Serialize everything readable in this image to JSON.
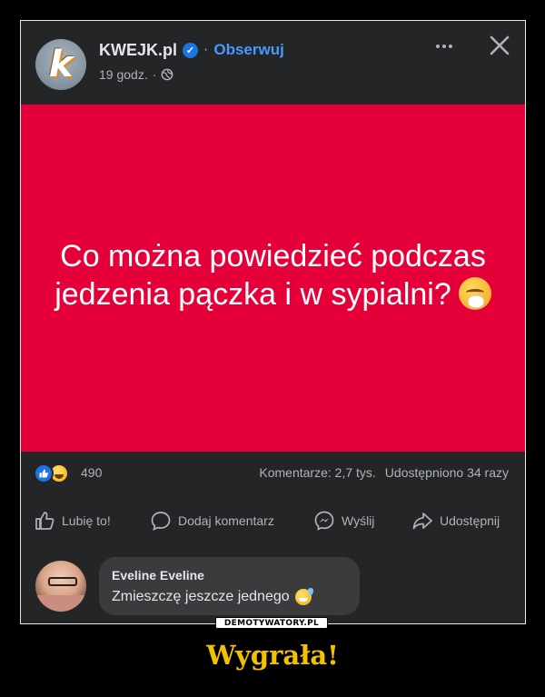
{
  "post": {
    "page_name": "KWEJK.pl",
    "separator": "·",
    "follow_label": "Obserwuj",
    "time": "19 godz.",
    "time_separator": "·",
    "avatar_letter": "k",
    "image_text": "Co można powiedzieć podczas jedzenia pączka i w sypialni?",
    "image_bg_color": "#e5003a"
  },
  "stats": {
    "reactions_count": "490",
    "comments": "Komentarze: 2,7 tys.",
    "shares": "Udostępniono 34 razy"
  },
  "actions": {
    "like": "Lubię to!",
    "comment": "Dodaj komentarz",
    "send": "Wyślij",
    "share": "Udostępnij"
  },
  "comment": {
    "author": "Eveline Eveline",
    "text": "Zmieszczę jeszcze jednego"
  },
  "watermark": "DEMOTYWATORY.PL",
  "caption": "Wygrała!",
  "colors": {
    "caption": "#f2c200",
    "accent_blue": "#1b74e4",
    "follow_blue": "#4599ff",
    "panel": "#242526"
  }
}
